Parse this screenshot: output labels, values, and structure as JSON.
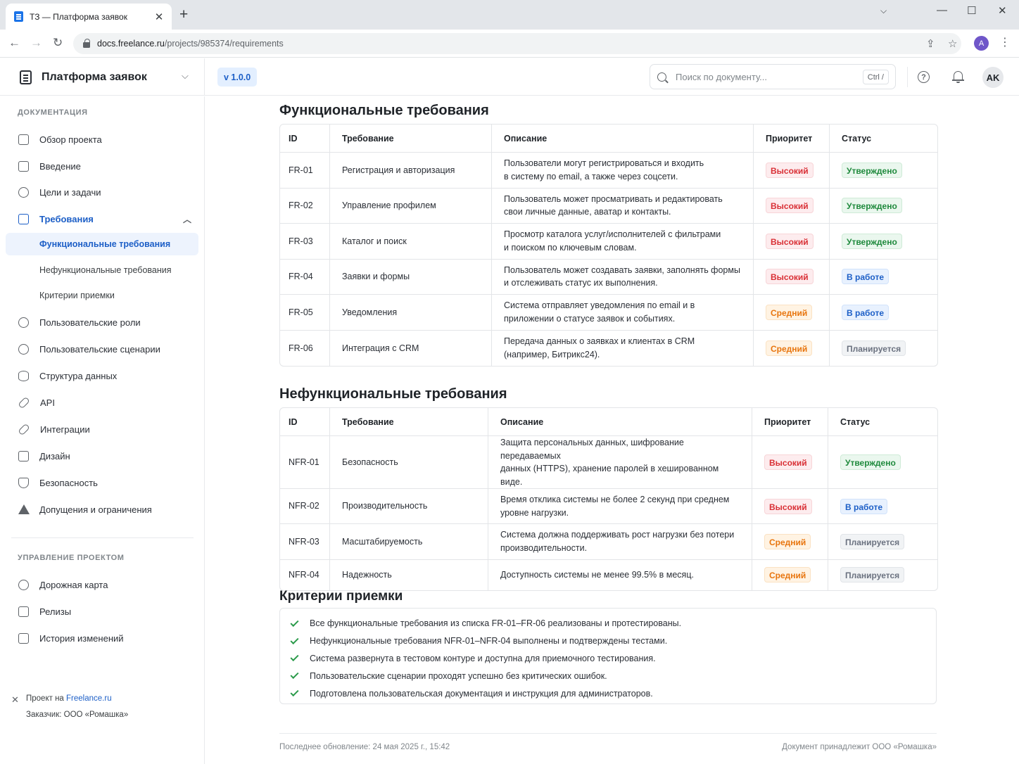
{
  "browser": {
    "tab_title": "ТЗ — Платформа заявок",
    "url_host": "docs.freelance.ru",
    "url_path": "/projects/985374/requirements",
    "profile_initial": "A"
  },
  "header": {
    "title": "Платформа заявок",
    "version": "v 1.0.0",
    "search_placeholder": "Поиск по документу...",
    "search_shortcut": "Ctrl /",
    "help_symbol": "?",
    "user_initials": "AK"
  },
  "sidebar": {
    "section_docs": "ДОКУМЕНТАЦИЯ",
    "items": [
      {
        "label": "Обзор проекта"
      },
      {
        "label": "Введение"
      },
      {
        "label": "Цели и задачи"
      },
      {
        "label": "Требования"
      },
      {
        "label": "Пользовательские роли"
      },
      {
        "label": "Пользовательские сценарии"
      },
      {
        "label": "Структура данных"
      },
      {
        "label": "API"
      },
      {
        "label": "Интеграции"
      },
      {
        "label": "Дизайн"
      },
      {
        "label": "Безопасность"
      },
      {
        "label": "Допущения и ограничения"
      }
    ],
    "sub_items": [
      {
        "label": "Функциональные требования"
      },
      {
        "label": "Нефункциональные требования"
      },
      {
        "label": "Критерии приемки"
      }
    ],
    "section_pm": "УПРАВЛЕНИЕ ПРОЕКТОМ",
    "pm_items": [
      {
        "label": "Дорожная карта"
      },
      {
        "label": "Релизы"
      },
      {
        "label": "История изменений"
      }
    ],
    "footer_project_prefix": "Проект на",
    "footer_project_link": "Freelance.ru",
    "footer_client": "Заказчик: ООО «Ромашка»"
  },
  "functional": {
    "title": "Функциональные требования",
    "headers": {
      "id": "ID",
      "req": "Требование",
      "desc": "Описание",
      "priority": "Приоритет",
      "status": "Статус"
    },
    "rows": [
      {
        "id": "FR-01",
        "req": "Регистрация и авторизация",
        "desc1": "Пользователи могут регистрироваться и входить",
        "desc2": "в систему по email, а также через соцсети.",
        "priority": "Высокий",
        "status": "Утверждено"
      },
      {
        "id": "FR-02",
        "req": "Управление профилем",
        "desc1": "Пользователь может просматривать и редактировать",
        "desc2": "свои личные данные, аватар и контакты.",
        "priority": "Высокий",
        "status": "Утверждено"
      },
      {
        "id": "FR-03",
        "req": "Каталог и поиск",
        "desc1": "Просмотр каталога услуг/исполнителей с фильтрами",
        "desc2": "и поиском по ключевым словам.",
        "priority": "Высокий",
        "status": "Утверждено"
      },
      {
        "id": "FR-04",
        "req": "Заявки и формы",
        "desc1": "Пользователь может создавать заявки, заполнять формы",
        "desc2": "и отслеживать статус их выполнения.",
        "priority": "Высокий",
        "status": "В работе"
      },
      {
        "id": "FR-05",
        "req": "Уведомления",
        "desc1": "Система отправляет уведомления по email и в",
        "desc2": "приложении о статусе заявок и событиях.",
        "priority": "Средний",
        "status": "В работе"
      },
      {
        "id": "FR-06",
        "req": "Интеграция с CRM",
        "desc1": "Передача данных о заявках и клиентах в CRM",
        "desc2": "(например, Битрикс24).",
        "priority": "Средний",
        "status": "Планируется"
      }
    ]
  },
  "nonfunctional": {
    "title": "Нефункциональные требования",
    "headers": {
      "id": "ID",
      "req": "Требование",
      "desc": "Описание",
      "priority": "Приоритет",
      "status": "Статус"
    },
    "rows": [
      {
        "id": "NFR-01",
        "req": "Безопасность",
        "desc1": "Защита персональных данных, шифрование передаваемых",
        "desc2": "данных (HTTPS), хранение паролей в хешированном виде.",
        "priority": "Высокий",
        "status": "Утверждено"
      },
      {
        "id": "NFR-02",
        "req": "Производительность",
        "desc1": "Время отклика системы не более 2 секунд при среднем",
        "desc2": "уровне нагрузки.",
        "priority": "Высокий",
        "status": "В работе"
      },
      {
        "id": "NFR-03",
        "req": "Масштабируемость",
        "desc1": "Система должна поддерживать рост нагрузки без потери",
        "desc2": "производительности.",
        "priority": "Средний",
        "status": "Планируется"
      },
      {
        "id": "NFR-04",
        "req": "Надежность",
        "desc1": "Доступность системы не менее 99.5% в месяц.",
        "desc2": "",
        "priority": "Средний",
        "status": "Планируется"
      }
    ]
  },
  "criteria": {
    "title": "Критерии приемки",
    "items": [
      "Все функциональные требования из списка FR-01–FR-06 реализованы и протестированы.",
      "Нефункциональные требования NFR-01–NFR-04 выполнены и подтверждены тестами.",
      "Система развернута в тестовом контуре и доступна для приемочного тестирования.",
      "Пользовательские сценарии проходят успешно без критических ошибок.",
      "Подготовлена пользовательская документация и инструкция для администраторов."
    ]
  },
  "footer": {
    "updated": "Последнее обновление: 24 мая 2025 г., 15:42",
    "owner": "Документ принадлежит ООО «Ромашка»"
  }
}
